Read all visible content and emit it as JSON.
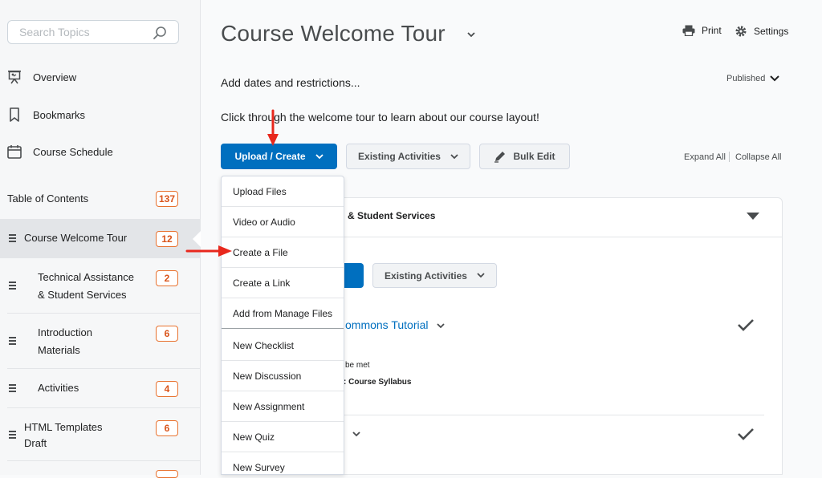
{
  "search": {
    "placeholder": "Search Topics"
  },
  "sidebar": {
    "nav": [
      {
        "label": "Overview",
        "icon": "presentation-icon"
      },
      {
        "label": "Bookmarks",
        "icon": "bookmark-icon"
      },
      {
        "label": "Course Schedule",
        "icon": "calendar-icon"
      }
    ],
    "toc": {
      "label": "Table of Contents",
      "count": "137",
      "items": [
        {
          "label": "Course Welcome Tour",
          "count": "12"
        },
        {
          "line1": "Technical Assistance",
          "line2": "& Student Services",
          "count": "2"
        },
        {
          "line1": "Introduction",
          "line2": "Materials",
          "count": "6"
        },
        {
          "label": "Activities",
          "count": "4"
        },
        {
          "line1": "HTML Templates",
          "line2": "Draft",
          "count": "6"
        }
      ]
    }
  },
  "header": {
    "title": "Course Welcome Tour",
    "print": "Print",
    "settings": "Settings",
    "dates_link": "Add dates and restrictions...",
    "status": "Published"
  },
  "intro_text": "Click through the welcome tour to learn about our course layout!",
  "toolbar": {
    "upload_create": "Upload / Create",
    "existing_activities": "Existing Activities",
    "bulk_edit": "Bulk Edit",
    "expand_all": "Expand All",
    "collapse_all": "Collapse All"
  },
  "dropdown": {
    "items": [
      "Upload Files",
      "Video or Audio",
      "Create a File",
      "Create a Link",
      "Add from Manage Files",
      "New Checklist",
      "New Discussion",
      "New Assignment",
      "New Quiz",
      "New Survey"
    ]
  },
  "panel": {
    "heading": "& Student Services",
    "existing_activities": "Existing Activities",
    "item_title": "ommons Tutorial",
    "condition": "be met",
    "condition_target": ": Course Syllabus"
  },
  "colors": {
    "primary": "#006fbf",
    "badge": "#e8722f",
    "annotation_arrow": "#e8281d"
  }
}
